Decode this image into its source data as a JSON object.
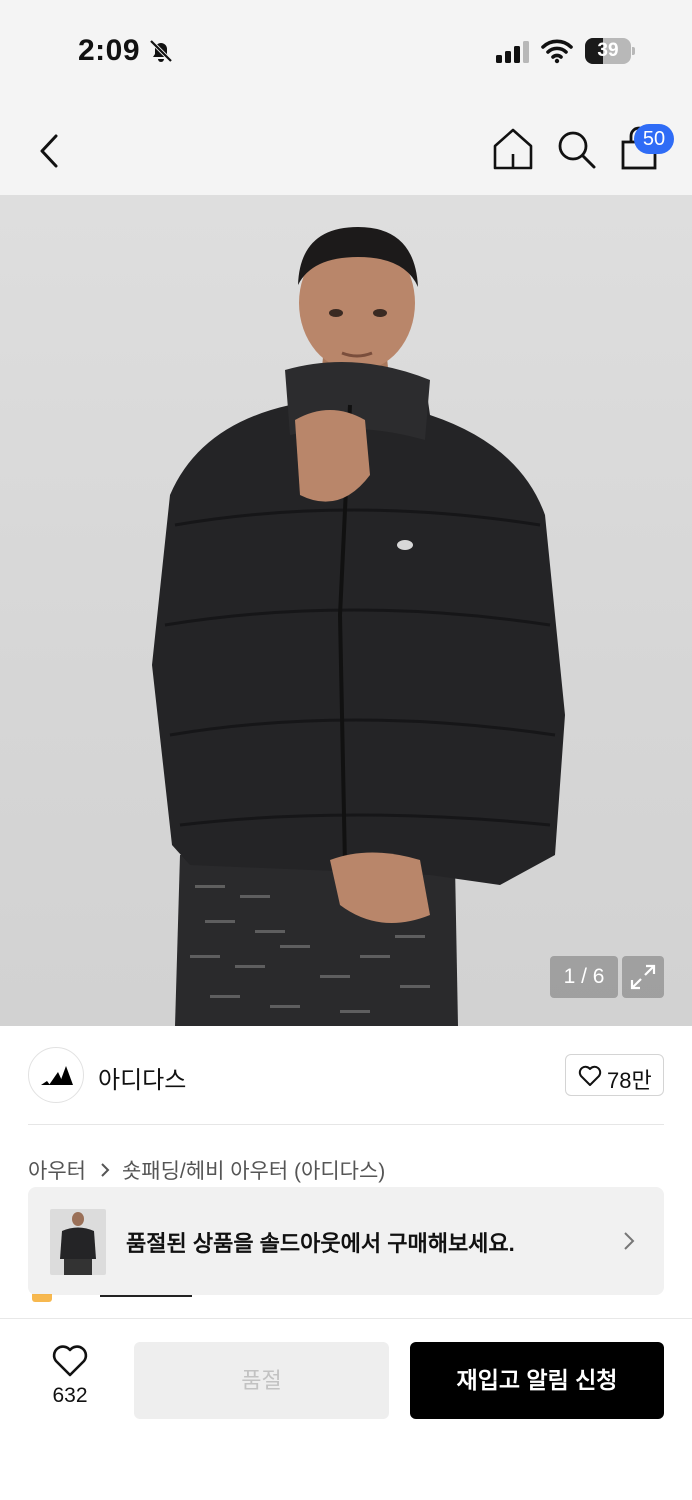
{
  "status_bar": {
    "time": "2:09",
    "battery_level": "39",
    "battery_fraction": 0.39,
    "icons": [
      "bell-off-icon",
      "signal-icon",
      "wifi-icon",
      "battery-icon"
    ]
  },
  "header": {
    "cart_count": "50",
    "icons": [
      "chevron-left-icon",
      "home-icon",
      "search-icon",
      "shopping-bag-icon"
    ]
  },
  "gallery": {
    "counter": "1 / 6",
    "current": 1,
    "total": 6,
    "expand_icon": "expand-icon"
  },
  "brand": {
    "name": "아디다스",
    "likes": "78만",
    "logo_icon": "adidas-logo-icon",
    "like_icon": "heart-icon"
  },
  "breadcrumb": {
    "category": "아우터",
    "subcategory": "숏패딩/헤비 아우터 (아디다스)"
  },
  "soldout_banner": {
    "text": "품절된 상품을 솔드아웃에서 구매해보세요."
  },
  "bottom_bar": {
    "wish_count": "632",
    "soldout_label": "품절",
    "restock_label": "재입고 알림 신청"
  },
  "colors": {
    "badge_blue": "#2f6cf6",
    "primary_black": "#000000",
    "disabled_gray": "#eeeeee"
  }
}
